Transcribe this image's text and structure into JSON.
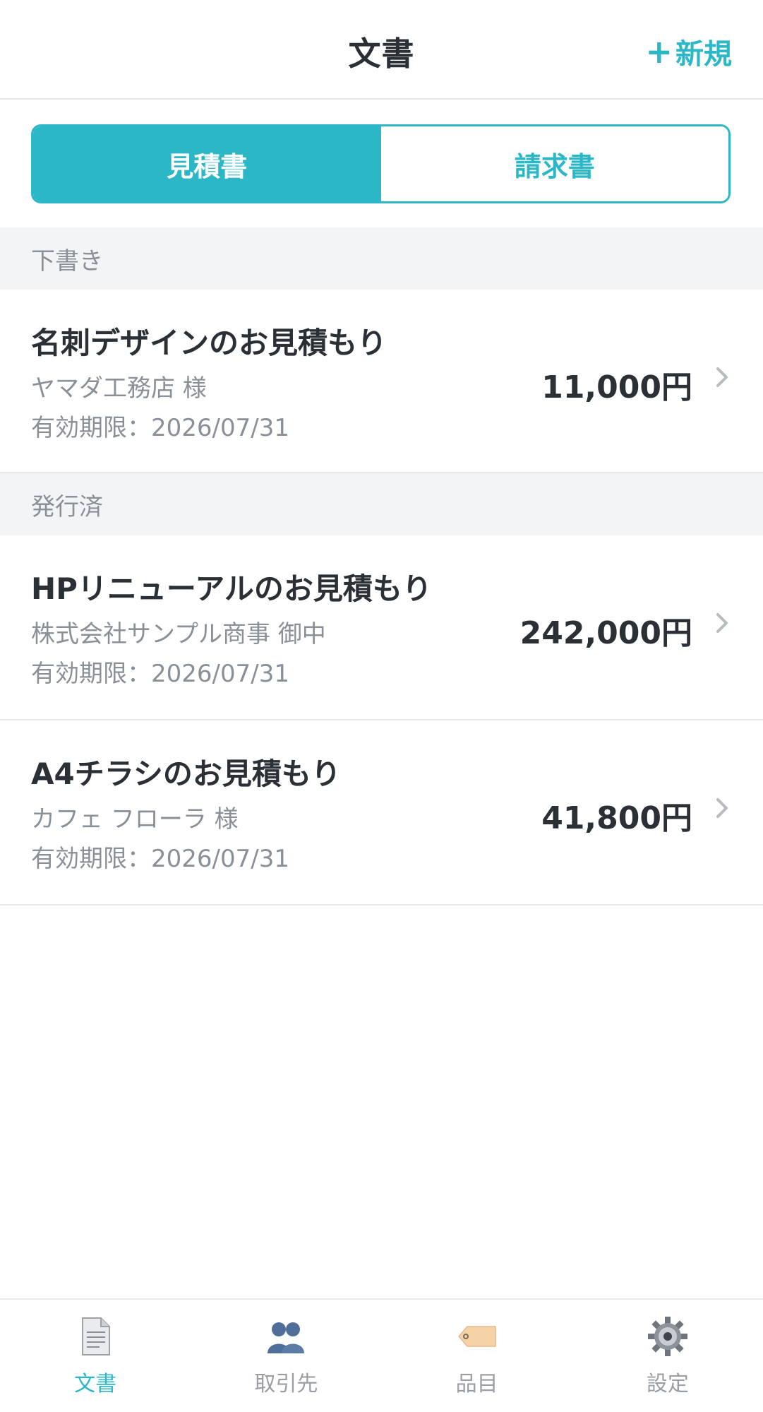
{
  "header": {
    "title": "文書",
    "new_label": "新規"
  },
  "segment": {
    "active": "見積書",
    "inactive": "請求書"
  },
  "sections": [
    {
      "title": "下書き",
      "items": [
        {
          "name": "名刺デザインのお見積もり",
          "client": "ヤマダ工務店 様",
          "expiry": "有効期限：2026/07/31",
          "amount": "11,000円"
        }
      ]
    },
    {
      "title": "発行済",
      "items": [
        {
          "name": "HPリニューアルのお見積もり",
          "client": "株式会社サンプル商事 御中",
          "expiry": "有効期限：2026/07/31",
          "amount": "242,000円"
        },
        {
          "name": "A4チラシのお見積もり",
          "client": "カフェ フローラ 様",
          "expiry": "有効期限：2026/07/31",
          "amount": "41,800円"
        }
      ]
    }
  ],
  "tabbar": [
    {
      "label": "文書",
      "icon": "document-icon",
      "active": true
    },
    {
      "label": "取引先",
      "icon": "people-icon",
      "active": false
    },
    {
      "label": "品目",
      "icon": "tag-icon",
      "active": false
    },
    {
      "label": "設定",
      "icon": "gear-icon",
      "active": false
    }
  ],
  "colors": {
    "accent": "#2bb7c6",
    "text": "#2b3036",
    "muted": "#8a9097",
    "section_bg": "#f3f4f6"
  }
}
